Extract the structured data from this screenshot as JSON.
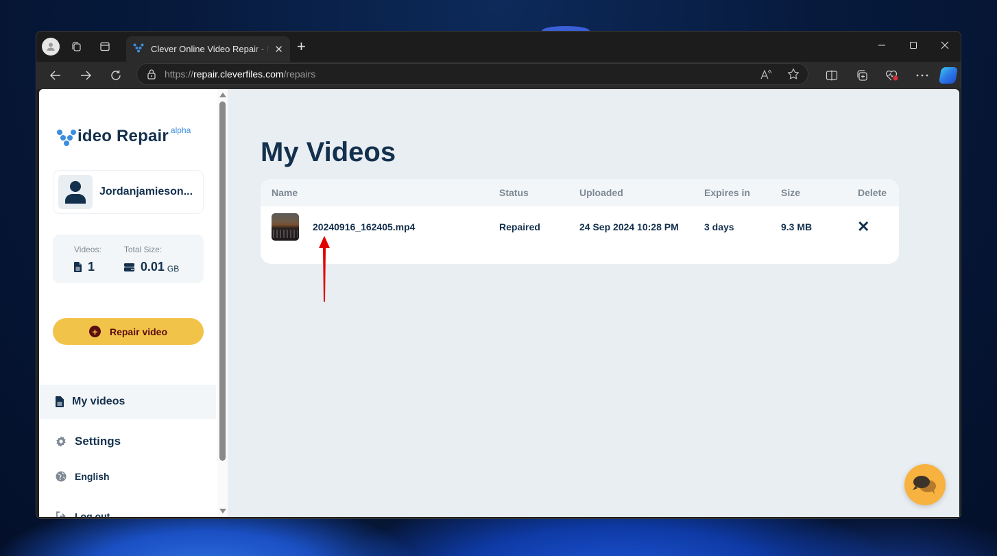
{
  "browser": {
    "tab_title": "Clever Online Video Repair - My Videos",
    "url": {
      "scheme": "https://",
      "host": "repair.cleverfiles.com",
      "path": "/repairs"
    },
    "new_tab_symbol": "+",
    "window_controls": {
      "minimize": "—",
      "maximize": "▢",
      "close": "✕"
    }
  },
  "sidebar": {
    "logo": {
      "text": "ideo Repair",
      "superscript": "alpha"
    },
    "user": {
      "name": "Jordanjamieson..."
    },
    "stats": {
      "videos_label": "Videos:",
      "videos_value": "1",
      "size_label": "Total Size:",
      "size_value": "0.01",
      "size_unit": "GB"
    },
    "repair_button": {
      "label": "Repair video",
      "icon": "plus-circle-icon"
    },
    "nav": [
      {
        "label": "My videos",
        "icon": "file-icon",
        "active": true
      },
      {
        "label": "Settings",
        "icon": "gear-icon",
        "active": false
      },
      {
        "label": "English",
        "icon": "globe-icon",
        "active": false
      },
      {
        "label": "Log out",
        "icon": "logout-icon",
        "active": false
      }
    ]
  },
  "main": {
    "title": "My Videos",
    "table": {
      "headers": {
        "name": "Name",
        "status": "Status",
        "uploaded": "Uploaded",
        "expires": "Expires in",
        "size": "Size",
        "delete": "Delete"
      },
      "rows": [
        {
          "name": "20240916_162405.mp4",
          "status": "Repaired",
          "uploaded": "24 Sep 2024 10:28 PM",
          "expires": "3 days",
          "size": "9.3 MB",
          "delete_symbol": "✕"
        }
      ]
    }
  },
  "colors": {
    "brand_navy": "#13304d",
    "brand_blue": "#3b8ede",
    "repair_yellow": "#f2c349",
    "repair_text": "#5a0e0e",
    "chat_orange": "#f7b23f",
    "annotation_red": "#e00000"
  }
}
